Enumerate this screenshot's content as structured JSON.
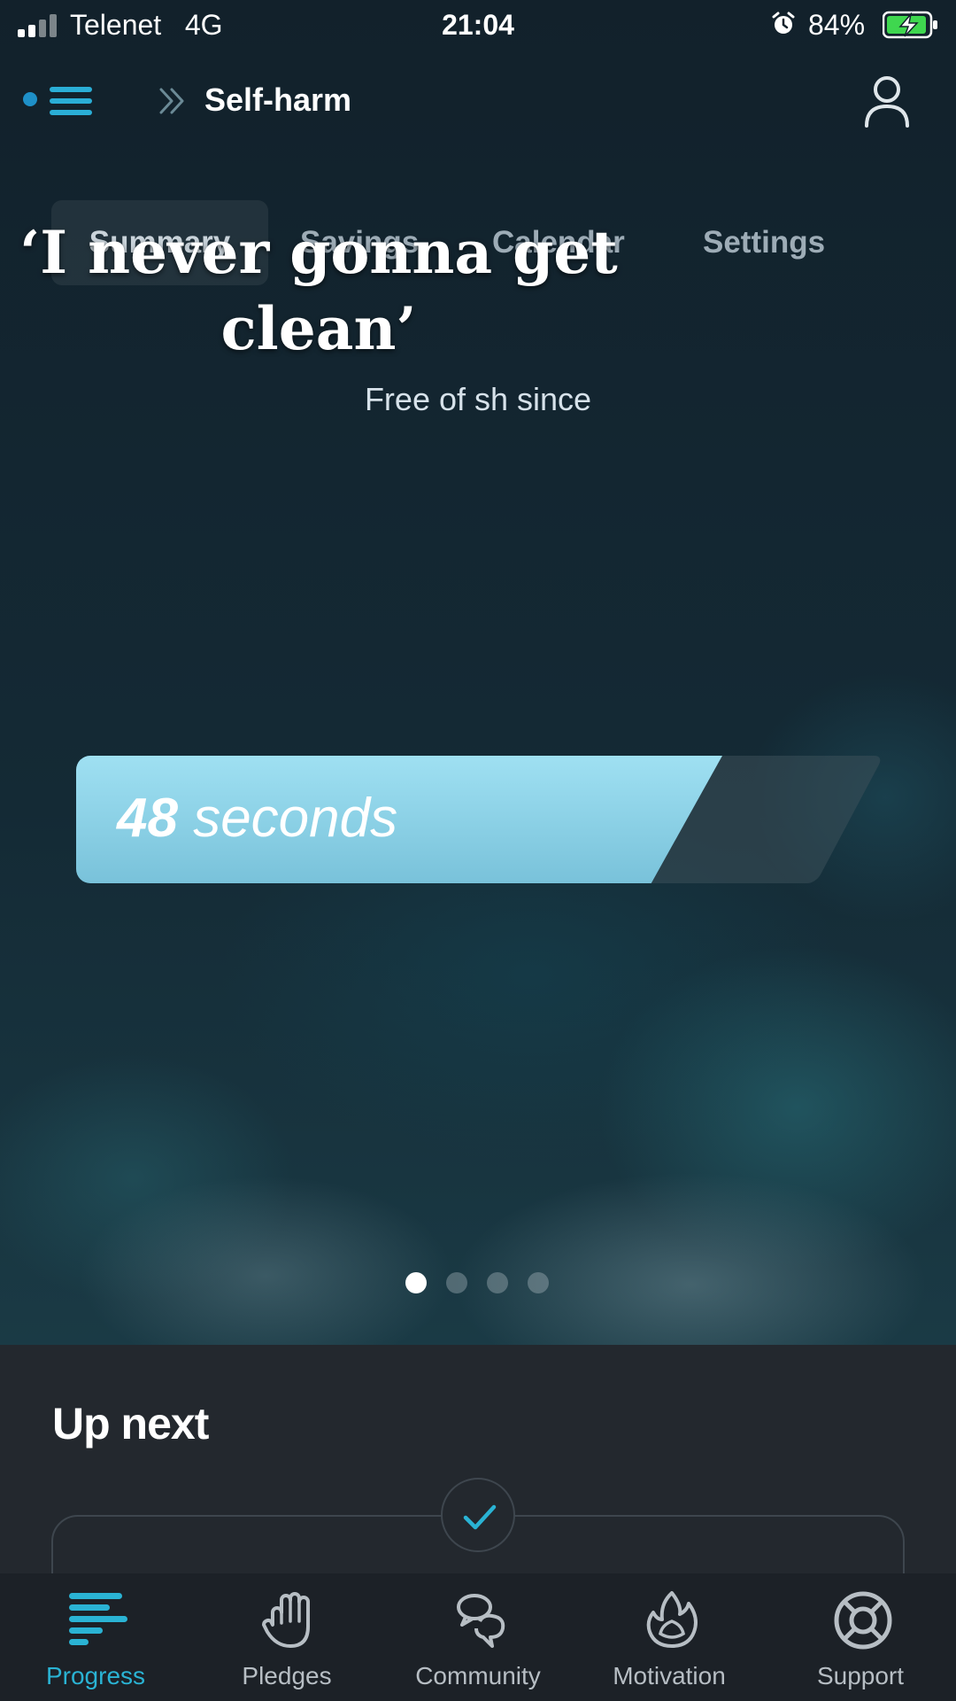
{
  "status_bar": {
    "carrier": "Telenet",
    "network": "4G",
    "time": "21:04",
    "battery_percent": "84%",
    "alarm_icon": "alarm-clock-icon",
    "battery_charging": true
  },
  "nav": {
    "title": "Self-harm",
    "menu_icon": "hamburger-menu-icon",
    "profile_icon": "user-profile-icon"
  },
  "tabs": [
    {
      "label": "Summary",
      "active": true
    },
    {
      "label": "Savings",
      "active": false
    },
    {
      "label": "Calendar",
      "active": false
    },
    {
      "label": "Settings",
      "active": false
    }
  ],
  "overlay_caption": "‘I never gonna get clean’",
  "hero": {
    "free_since_label": "Free of sh since",
    "timer_value": "48",
    "timer_unit": "seconds",
    "page_dots": {
      "count": 4,
      "active_index": 0
    }
  },
  "up_next": {
    "heading": "Up next"
  },
  "bottom_nav": [
    {
      "label": "Progress",
      "icon": "progress-bars-icon",
      "active": true
    },
    {
      "label": "Pledges",
      "icon": "raised-hand-icon",
      "active": false
    },
    {
      "label": "Community",
      "icon": "chat-bubbles-icon",
      "active": false
    },
    {
      "label": "Motivation",
      "icon": "flame-icon",
      "active": false
    },
    {
      "label": "Support",
      "icon": "lifebuoy-icon",
      "active": false
    }
  ],
  "colors": {
    "accent": "#2ab3d4",
    "timer_bar": "#9fe0f2",
    "panel_bg": "#23282e",
    "tabbar_bg": "#1c2127"
  }
}
